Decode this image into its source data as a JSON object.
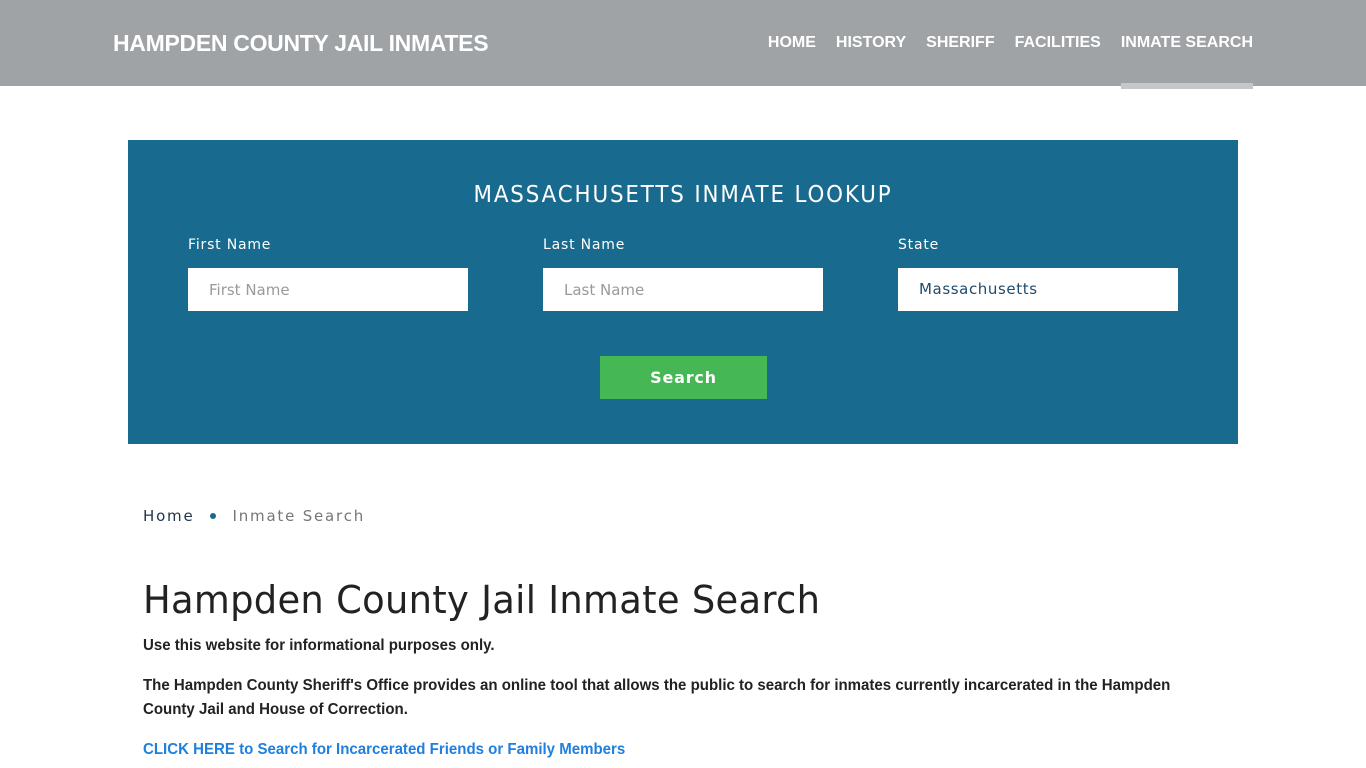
{
  "header": {
    "brand": "HAMPDEN COUNTY JAIL INMATES",
    "nav": [
      {
        "label": "HOME",
        "active": false
      },
      {
        "label": "HISTORY",
        "active": false
      },
      {
        "label": "SHERIFF",
        "active": false
      },
      {
        "label": "FACILITIES",
        "active": false
      },
      {
        "label": "INMATE SEARCH",
        "active": true
      }
    ]
  },
  "lookup": {
    "title": "MASSACHUSETTS INMATE LOOKUP",
    "first_name": {
      "label": "First Name",
      "placeholder": "First Name",
      "value": ""
    },
    "last_name": {
      "label": "Last Name",
      "placeholder": "Last Name",
      "value": ""
    },
    "state": {
      "label": "State",
      "value": "Massachusetts"
    },
    "search_label": "Search"
  },
  "breadcrumb": {
    "home": "Home",
    "current": "Inmate Search"
  },
  "content": {
    "title": "Hampden County Jail Inmate Search",
    "disclaimer": "Use this website for informational purposes only.",
    "description": "The Hampden County Sheriff's Office provides an online tool that allows the public to search for inmates currently incarcerated in the Hampden County Jail and House of Correction.",
    "cta_link": "CLICK HERE to Search for Incarcerated Friends or Family Members"
  },
  "colors": {
    "header_bg": "#9fa3a6",
    "lookup_bg": "#186b8e",
    "search_button": "#46b755",
    "link": "#1f7fe0"
  }
}
